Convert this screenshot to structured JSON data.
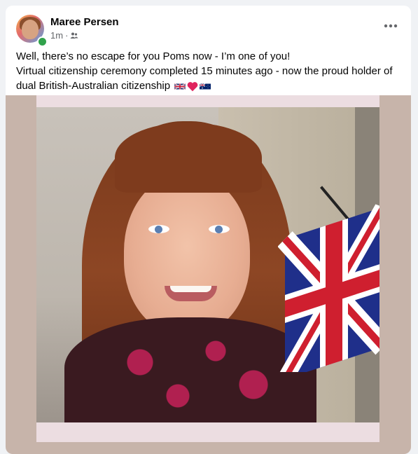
{
  "post": {
    "author": "Maree Persen",
    "timestamp": "1m",
    "separator": "·",
    "audience_icon": "friends-icon",
    "more_icon": "more-options-icon",
    "text": {
      "line1": "Well, there’s no escape for you Poms now - I’m one of you!",
      "line2": "Virtual citizenship ceremony completed 15 minutes ago - now the proud holder of dual British-Australian citizenship"
    },
    "emojis": [
      "uk-flag-emoji",
      "red-heart-emoji",
      "australia-flag-emoji"
    ]
  },
  "colors": {
    "online": "#31a24c",
    "meta_text": "#65676b",
    "background": "#f0f2f5"
  }
}
